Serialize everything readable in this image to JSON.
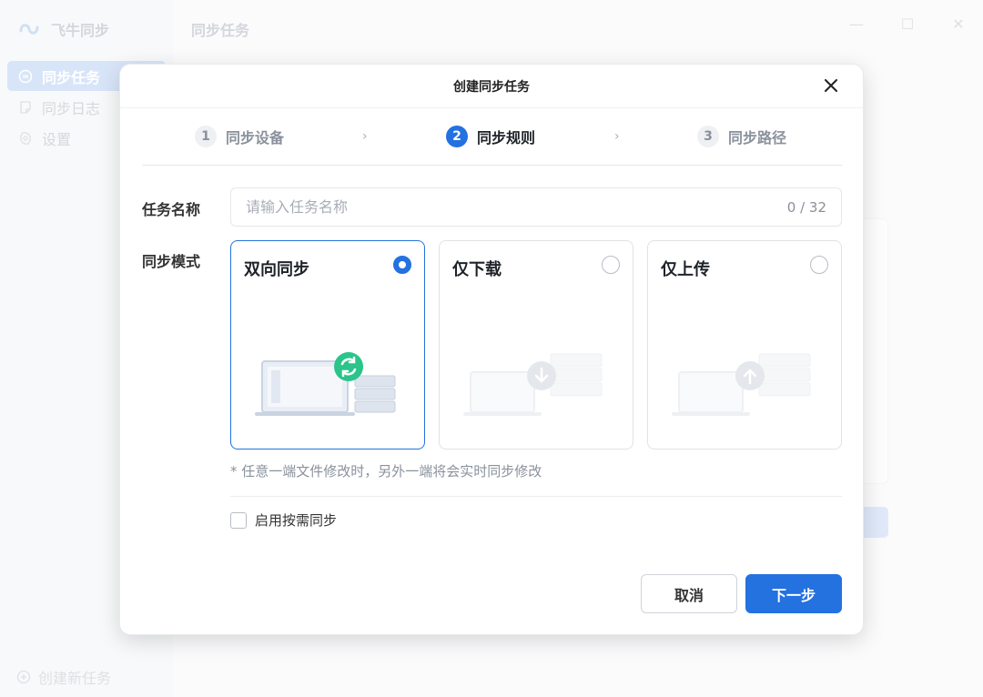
{
  "app": {
    "name": "飞牛同步",
    "page_title": "同步任务",
    "window_controls": {
      "minimize": "—",
      "maximize": "☐",
      "close": "✕"
    }
  },
  "sidebar": {
    "items": [
      {
        "label": "同步任务",
        "icon": "sync-task-icon",
        "active": true
      },
      {
        "label": "同步日志",
        "icon": "log-icon",
        "active": false
      },
      {
        "label": "设置",
        "icon": "gear-icon",
        "active": false
      }
    ],
    "new_task_label": "创建新任务"
  },
  "dialog": {
    "title": "创建同步任务",
    "steps": [
      {
        "num": "1",
        "label": "同步设备",
        "active": false
      },
      {
        "num": "2",
        "label": "同步规则",
        "active": true
      },
      {
        "num": "3",
        "label": "同步路径",
        "active": false
      }
    ],
    "task_name": {
      "label": "任务名称",
      "placeholder": "请输入任务名称",
      "value": "",
      "counter": "0 / 32"
    },
    "sync_mode": {
      "label": "同步模式",
      "options": [
        {
          "label": "双向同步",
          "selected": true,
          "illustration": "two-way-sync-illustration"
        },
        {
          "label": "仅下载",
          "selected": false,
          "illustration": "download-only-illustration"
        },
        {
          "label": "仅上传",
          "selected": false,
          "illustration": "upload-only-illustration"
        }
      ],
      "hint": "* 任意一端文件修改时，另外一端将会实时同步修改"
    },
    "on_demand": {
      "label": "启用按需同步",
      "checked": false
    },
    "buttons": {
      "cancel": "取消",
      "next": "下一步"
    }
  },
  "colors": {
    "accent": "#2471e0",
    "sync_green": "#2bc48a"
  }
}
